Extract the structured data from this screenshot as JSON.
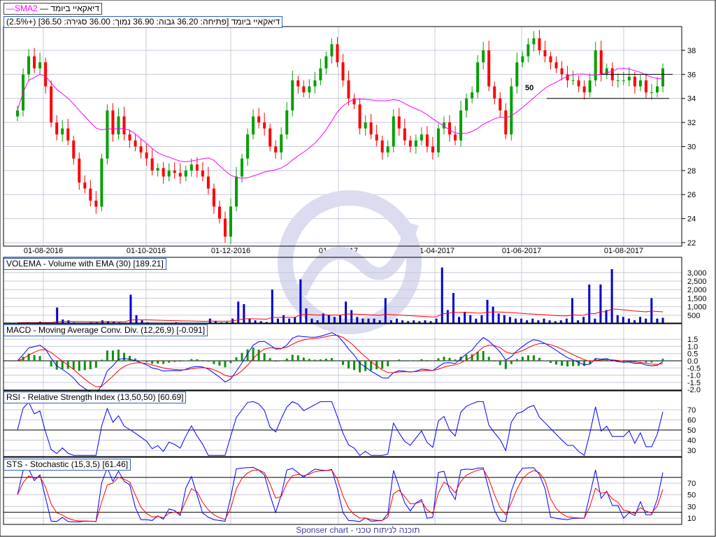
{
  "legend": {
    "series_name": "דיאקאיי ביומד",
    "sma_name": "SMA2"
  },
  "price_header": "דיאקאיי ביומד [פתיחה: 36.20  גבוה: 36.90  נמוך: 36.00  סגירה: 36.50] (+2.5%)",
  "annotation": "50",
  "footer": "Sponser chart - תוכנה לניתוח טכני",
  "colors": {
    "up": "#00a000",
    "down": "#ff0000",
    "sma": "#ff00ff",
    "volume": "#0000cc",
    "ema": "#ff0000",
    "grid": "#c8c8dc"
  },
  "chart_data": [
    {
      "type": "candlestick",
      "title": "דיאקאיי ביומד",
      "x_ticks": [
        "01-08-2016",
        "01-10-2016",
        "01-12-2016",
        "01-02-2017",
        "01-04-2017",
        "01-06-2017",
        "01-08-2017"
      ],
      "y_ticks": [
        22,
        24,
        26,
        28,
        30,
        32,
        34,
        36,
        38
      ],
      "ylim": [
        22,
        38
      ],
      "close": [
        33,
        36,
        37.5,
        36.5,
        37,
        35,
        32,
        31,
        31.5,
        30.5,
        29,
        27,
        26.5,
        25.5,
        25,
        29,
        33,
        31,
        32.5,
        31,
        30.5,
        30,
        29.5,
        29,
        28,
        28.2,
        27.5,
        28,
        27.8,
        27.5,
        28,
        28.5,
        28,
        27.5,
        26.5,
        25,
        24,
        22.5,
        25,
        27.5,
        29,
        31,
        32.5,
        32,
        31.5,
        30,
        29.5,
        31,
        33,
        35.5,
        35,
        34.5,
        35,
        35.5,
        36.5,
        37.5,
        38.5,
        37,
        35.5,
        34,
        33.5,
        31.5,
        32,
        31,
        30.5,
        29.5,
        30,
        32.5,
        31.5,
        30.5,
        30,
        30.5,
        31,
        30,
        29.5,
        31.5,
        32,
        31,
        30.5,
        33,
        34,
        34.5,
        37,
        38,
        35,
        34,
        33,
        31,
        35,
        37,
        37.5,
        38.5,
        39,
        38,
        37.5,
        37,
        36.5,
        36,
        35.5,
        35.5,
        35,
        34.5,
        35.5,
        38,
        36,
        36.5,
        35.5,
        35.5,
        35.5,
        35.8,
        35,
        35.5,
        34.5,
        34.5,
        35,
        36.5
      ],
      "sma_period": 20,
      "support_lines": [
        34,
        36
      ]
    },
    {
      "type": "bar",
      "title": "VOLEMA - Volume with EMA (30) [189.21]",
      "y_ticks": [
        500,
        1000,
        1500,
        2000,
        2500,
        3000
      ],
      "ema_period": 30,
      "volume": [
        60,
        80,
        90,
        60,
        120,
        90,
        60,
        950,
        250,
        200,
        80,
        60,
        60,
        80,
        80,
        200,
        150,
        100,
        80,
        60,
        1700,
        500,
        200,
        80,
        60,
        60,
        40,
        60,
        80,
        60,
        60,
        60,
        60,
        60,
        300,
        150,
        80,
        100,
        300,
        1300,
        1150,
        300,
        200,
        150,
        100,
        2000,
        300,
        500,
        300,
        400,
        2600,
        900,
        300,
        200,
        600,
        500,
        400,
        500,
        1300,
        800,
        400,
        300,
        300,
        300,
        200,
        1500,
        200,
        300,
        200,
        150,
        200,
        150,
        200,
        150,
        300,
        3300,
        800,
        1800,
        400,
        700,
        500,
        300,
        500,
        1400,
        1000,
        600,
        500,
        400,
        300,
        300,
        200,
        300,
        200,
        300,
        200,
        150,
        200,
        300,
        1500,
        200,
        400,
        2300,
        300,
        2300,
        800,
        3200,
        500,
        400,
        300,
        200,
        400,
        300,
        1500,
        300,
        350
      ],
      "last_value_label": "189.21"
    },
    {
      "type": "line",
      "title": "MACD - Moving Average Conv. Div. (12,26,9) [-0.091]",
      "y_ticks": [
        1.5,
        1.0,
        0.5,
        0.0,
        -0.5,
        -1.0,
        -1.5,
        -2.0
      ],
      "params": [
        12,
        26,
        9
      ]
    },
    {
      "type": "line",
      "title": "RSI - Relative Strength Index (13,50,50) [60.69]",
      "y_ticks": [
        70,
        60,
        50,
        40,
        30
      ],
      "period": 13,
      "level": 50
    },
    {
      "type": "line",
      "title": "STS - Stochastic (15,3,5) [61.46]",
      "y_ticks": [
        70,
        50,
        30,
        10
      ],
      "params": [
        15,
        3,
        5
      ],
      "levels": [
        80,
        20
      ]
    }
  ]
}
